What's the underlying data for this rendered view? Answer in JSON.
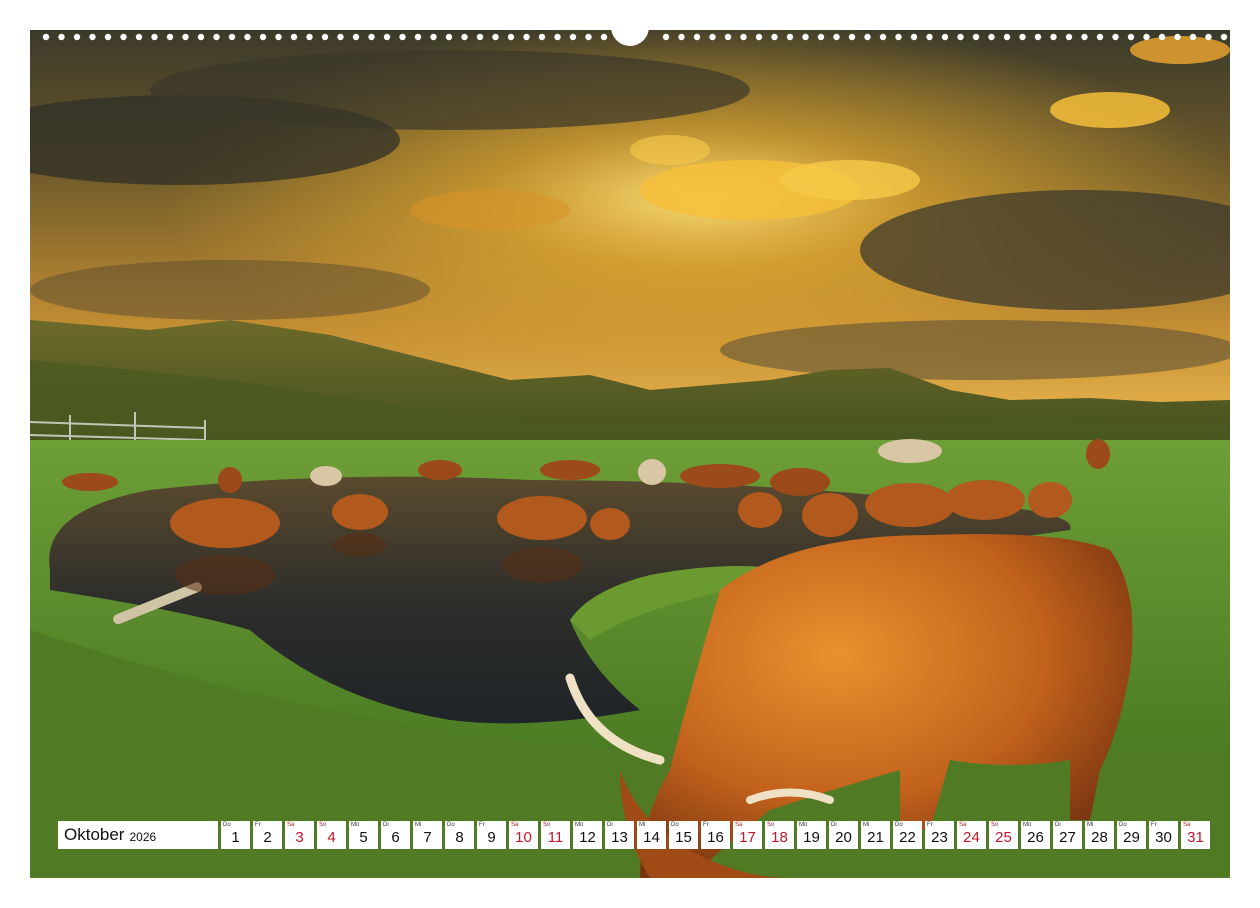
{
  "calendar": {
    "month": "Oktober",
    "year": "2026",
    "days": [
      {
        "wd": "Do",
        "num": "1",
        "weekend": false
      },
      {
        "wd": "Fr",
        "num": "2",
        "weekend": false
      },
      {
        "wd": "Sa",
        "num": "3",
        "weekend": true
      },
      {
        "wd": "So",
        "num": "4",
        "weekend": true
      },
      {
        "wd": "Mo",
        "num": "5",
        "weekend": false
      },
      {
        "wd": "Di",
        "num": "6",
        "weekend": false
      },
      {
        "wd": "Mi",
        "num": "7",
        "weekend": false
      },
      {
        "wd": "Do",
        "num": "8",
        "weekend": false
      },
      {
        "wd": "Fr",
        "num": "9",
        "weekend": false
      },
      {
        "wd": "Sa",
        "num": "10",
        "weekend": true
      },
      {
        "wd": "So",
        "num": "11",
        "weekend": true
      },
      {
        "wd": "Mo",
        "num": "12",
        "weekend": false
      },
      {
        "wd": "Di",
        "num": "13",
        "weekend": false
      },
      {
        "wd": "Mi",
        "num": "14",
        "weekend": false
      },
      {
        "wd": "Do",
        "num": "15",
        "weekend": false
      },
      {
        "wd": "Fr",
        "num": "16",
        "weekend": false
      },
      {
        "wd": "Sa",
        "num": "17",
        "weekend": true
      },
      {
        "wd": "So",
        "num": "18",
        "weekend": true
      },
      {
        "wd": "Mo",
        "num": "19",
        "weekend": false
      },
      {
        "wd": "Di",
        "num": "20",
        "weekend": false
      },
      {
        "wd": "Mi",
        "num": "21",
        "weekend": false
      },
      {
        "wd": "Do",
        "num": "22",
        "weekend": false
      },
      {
        "wd": "Fr",
        "num": "23",
        "weekend": false
      },
      {
        "wd": "Sa",
        "num": "24",
        "weekend": true
      },
      {
        "wd": "So",
        "num": "25",
        "weekend": true
      },
      {
        "wd": "Mo",
        "num": "26",
        "weekend": false
      },
      {
        "wd": "Di",
        "num": "27",
        "weekend": false
      },
      {
        "wd": "Mi",
        "num": "28",
        "weekend": false
      },
      {
        "wd": "Do",
        "num": "29",
        "weekend": false
      },
      {
        "wd": "Fr",
        "num": "30",
        "weekend": false
      },
      {
        "wd": "Sa",
        "num": "31",
        "weekend": true
      }
    ]
  },
  "colors": {
    "weekend": "#c0162a",
    "sky_gold": "#e8a81c",
    "grass": "#5f8c2c",
    "cattle": "#b8561c"
  }
}
